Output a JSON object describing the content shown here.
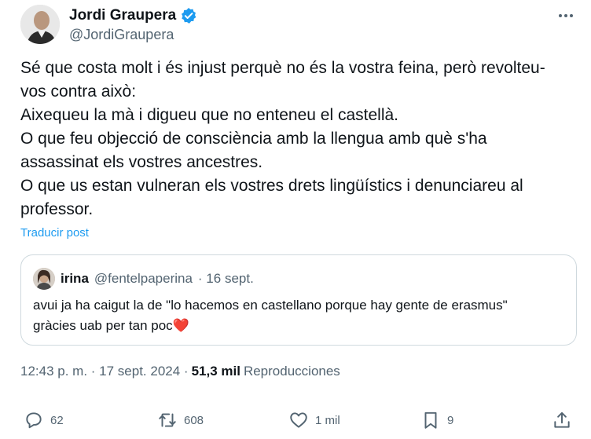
{
  "tweet": {
    "author_name": "Jordi Graupera",
    "author_handle": "@JordiGraupera",
    "text": "Sé que costa molt i és injust perquè no és la vostra feina, però revolteu-\nvos contra això:\nAixequeu la mà i digueu que no enteneu el castellà.\nO que feu objecció de consciència amb la llengua amb què s'ha\nassassinat els vostres ancestres.\nO que us estan vulneran els vostres drets lingüístics i denunciareu al\nprofessor.",
    "translate_label": "Traducir post"
  },
  "quote": {
    "name": "irina",
    "handle": "@fentelpaperina",
    "date": "· 16 sept.",
    "text": "avui ja ha caigut la de \"lo hacemos en castellano porque hay gente de erasmus\" gràcies uab per tan poc",
    "emoji": "❤️"
  },
  "meta": {
    "time": "12:43 p. m. · 17 sept. 2024 ·",
    "views_count": "51,3 mil",
    "views_label": "Reproducciones"
  },
  "actions": {
    "replies": "62",
    "reposts": "608",
    "likes": "1 mil",
    "bookmarks": "9"
  },
  "colors": {
    "accent": "#1d9bf0",
    "secondary_text": "#536471",
    "border": "#cfd9de",
    "heart": "#e0245e"
  }
}
